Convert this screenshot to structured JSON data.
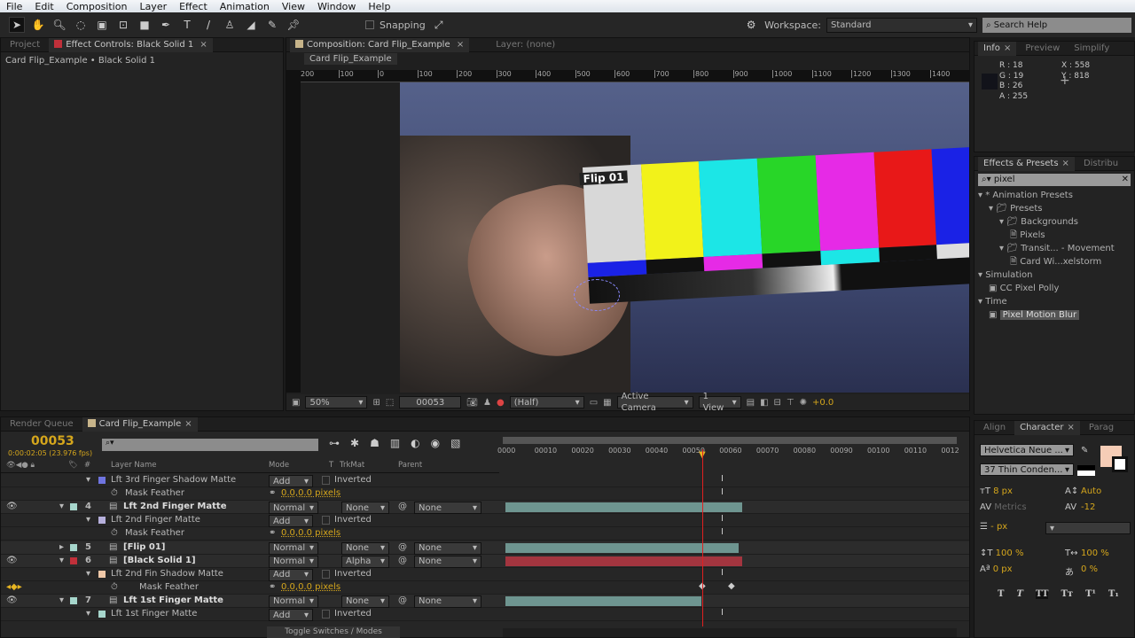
{
  "menu": [
    "File",
    "Edit",
    "Composition",
    "Layer",
    "Effect",
    "Animation",
    "View",
    "Window",
    "Help"
  ],
  "toolbar": {
    "snapping": "Snapping",
    "workspace_label": "Workspace:",
    "workspace": "Standard",
    "search_placeholder": "Search Help"
  },
  "left_panel": {
    "tab_project": "Project",
    "tab_effect_controls": "Effect Controls: Black Solid 1",
    "breadcrumb": "Card Flip_Example • Black Solid 1"
  },
  "comp_panel": {
    "tab": "Composition: Card Flip_Example",
    "tab_layer": "Layer: (none)",
    "subtab": "Card Flip_Example",
    "ruler": [
      "200",
      "100",
      "0",
      "100",
      "200",
      "300",
      "400",
      "500",
      "600",
      "700",
      "800",
      "900",
      "1000",
      "1100",
      "1200",
      "1300",
      "1400"
    ],
    "zoom": "50%",
    "timecode": "00053",
    "resolution": "(Half)",
    "camera": "Active Camera",
    "views": "1 View",
    "exposure": "+0.0",
    "overlay_label": "Flip 01"
  },
  "info": {
    "tabs": [
      "Info",
      "Preview",
      "Simplify"
    ],
    "r": "R : 18",
    "g": "G : 19",
    "b": "B : 26",
    "a": "A : 255",
    "x": "X : 558",
    "y": "Y : 818",
    "color": "#12131a"
  },
  "effects": {
    "tabs": [
      "Effects & Presets",
      "Distribu"
    ],
    "search": "pixel",
    "tree": [
      {
        "label": "* Animation Presets",
        "lvl": 0,
        "kind": "arrow"
      },
      {
        "label": "Presets",
        "lvl": 1,
        "kind": "folder"
      },
      {
        "label": "Backgrounds",
        "lvl": 2,
        "kind": "folder"
      },
      {
        "label": "Pixels",
        "lvl": 3,
        "kind": "file"
      },
      {
        "label": "Transit... - Movement",
        "lvl": 2,
        "kind": "folder"
      },
      {
        "label": "Card Wi...xelstorm",
        "lvl": 3,
        "kind": "file"
      },
      {
        "label": "Simulation",
        "lvl": 0,
        "kind": "arrow"
      },
      {
        "label": "CC Pixel Polly",
        "lvl": 1,
        "kind": "fx"
      },
      {
        "label": "Time",
        "lvl": 0,
        "kind": "arrow"
      },
      {
        "label": "Pixel Motion Blur",
        "lvl": 1,
        "kind": "fx",
        "selected": true
      }
    ]
  },
  "character": {
    "tabs": [
      "Align",
      "Character",
      "Parag"
    ],
    "font": "Helvetica Neue ...",
    "style": "37 Thin Conden...",
    "size": "8 px",
    "leading": "Auto",
    "kerning": "Metrics",
    "tracking": "-12",
    "stroke": "- px",
    "vscale": "100 %",
    "hscale": "100 %",
    "baseline": "0 px",
    "tsume": "0 %",
    "fill_color": "#f6cdb6",
    "buttons": [
      "T",
      "T",
      "TT",
      "Tт",
      "T¹",
      "T₁"
    ]
  },
  "timeline": {
    "tabs": [
      "Render Queue",
      "Card Flip_Example"
    ],
    "timecode": "00053",
    "fps": "0:00:02:05 (23.976 fps)",
    "headers": {
      "name": "Layer Name",
      "mode": "Mode",
      "t": "T",
      "trkmat": "TrkMat",
      "parent": "Parent"
    },
    "ruler": [
      "0000",
      "00010",
      "00020",
      "00030",
      "00040",
      "00050",
      "00060",
      "00070",
      "00080",
      "00090",
      "00100",
      "00110",
      "0012"
    ],
    "current_frame": 53,
    "toggle": "Toggle Switches / Modes",
    "rows": [
      {
        "type": "mask",
        "name": "Lft 3rd Finger Shadow Matte",
        "color": "#6f74e0",
        "mode": "Add",
        "inverted": "Inverted"
      },
      {
        "type": "prop",
        "name": "Mask Feather",
        "value": "0.0,0.0 pixels"
      },
      {
        "type": "layer",
        "num": "4",
        "name": "Lft 2nd Finger Matte",
        "color": "#a6d6cc",
        "mode": "Normal",
        "trkmat": "None",
        "parent": "None",
        "eye": true,
        "bar_end": 64,
        "bar_color": "#6e9590"
      },
      {
        "type": "mask",
        "name": "Lft 2nd Finger Matte",
        "color": "#b6b0dc",
        "mode": "Add",
        "inverted": "Inverted"
      },
      {
        "type": "prop",
        "name": "Mask Feather",
        "value": "0.0,0.0 pixels"
      },
      {
        "type": "layer",
        "num": "5",
        "name": "[Flip 01]",
        "color": "#a6d6cc",
        "mode": "Normal",
        "trkmat": "None",
        "parent": "None",
        "eye": false,
        "bar_end": 63,
        "bar_color": "#6e9590"
      },
      {
        "type": "layer",
        "num": "6",
        "name": "[Black Solid 1]",
        "color": "#c0303a",
        "mode": "Normal",
        "trkmat": "Alpha",
        "parent": "None",
        "eye": true,
        "bar_end": 64,
        "bar_color": "#a3353f"
      },
      {
        "type": "mask",
        "name": "Lft 2nd Fin Shadow Matte",
        "color": "#f0c8a8",
        "mode": "Add",
        "inverted": "Inverted"
      },
      {
        "type": "prop",
        "name": "Mask Feather",
        "value": "0.0,0.0 pixels",
        "keyframed": true
      },
      {
        "type": "layer",
        "num": "7",
        "name": "Lft 1st Finger Matte",
        "color": "#a6d6cc",
        "mode": "Normal",
        "trkmat": "None",
        "parent": "None",
        "eye": true,
        "bar_end": 53,
        "bar_color": "#6e9590"
      },
      {
        "type": "mask",
        "name": "Lft 1st Finger Matte",
        "color": "#a6d6cc",
        "mode": "Add",
        "inverted": "Inverted"
      }
    ]
  }
}
